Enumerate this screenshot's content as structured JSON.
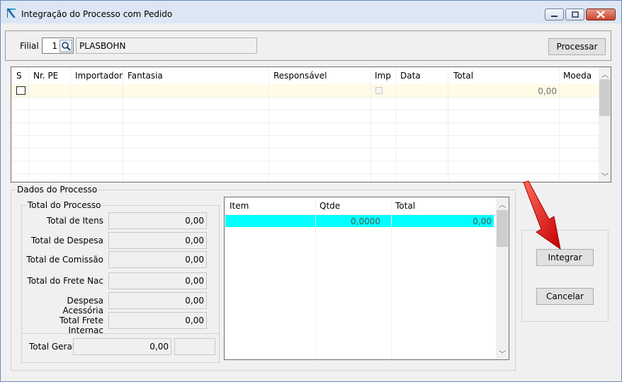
{
  "window": {
    "title": "Integração do Processo com Pedido",
    "accent": "#dce6f4",
    "icon": "app-logo-icon",
    "controls": [
      "minimize-icon",
      "maximize-icon",
      "close-icon"
    ]
  },
  "top": {
    "filial_label": "Filial",
    "filial_value": "1",
    "filial_name": "PLASBOHN",
    "process_button": "Processar"
  },
  "main_grid": {
    "columns": [
      "S",
      "Nr. PE",
      "Importador",
      "Fantasia",
      "Responsável",
      "Imp",
      "Data",
      "Total",
      "Moeda"
    ],
    "row_total": "0,00",
    "selected_row_color": "#fffbe6"
  },
  "dados": {
    "title": "Dados do Processo",
    "totals_title": "Total do Processo",
    "rows": [
      {
        "label": "Total de Itens",
        "value": "0,00"
      },
      {
        "label": "Total de Despesa",
        "value": "0,00"
      },
      {
        "label": "Total de Comissão",
        "value": "0,00"
      },
      {
        "label": "Total do Frete Nac",
        "value": "0,00"
      },
      {
        "label": "Despesa Acessória",
        "value": "0,00"
      },
      {
        "label": "Total Frete Internac",
        "value": "0,00"
      }
    ],
    "total_geral_label": "Total Geral",
    "total_geral_value": "0,00"
  },
  "items_grid": {
    "columns": [
      "Item",
      "Qtde",
      "Total"
    ],
    "row": {
      "qtde": "0,0000",
      "total": "0,00"
    },
    "highlight_color": "#00ffff"
  },
  "actions": {
    "integrar": "Integrar",
    "cancelar": "Cancelar",
    "pointer_color": "#e60000"
  }
}
